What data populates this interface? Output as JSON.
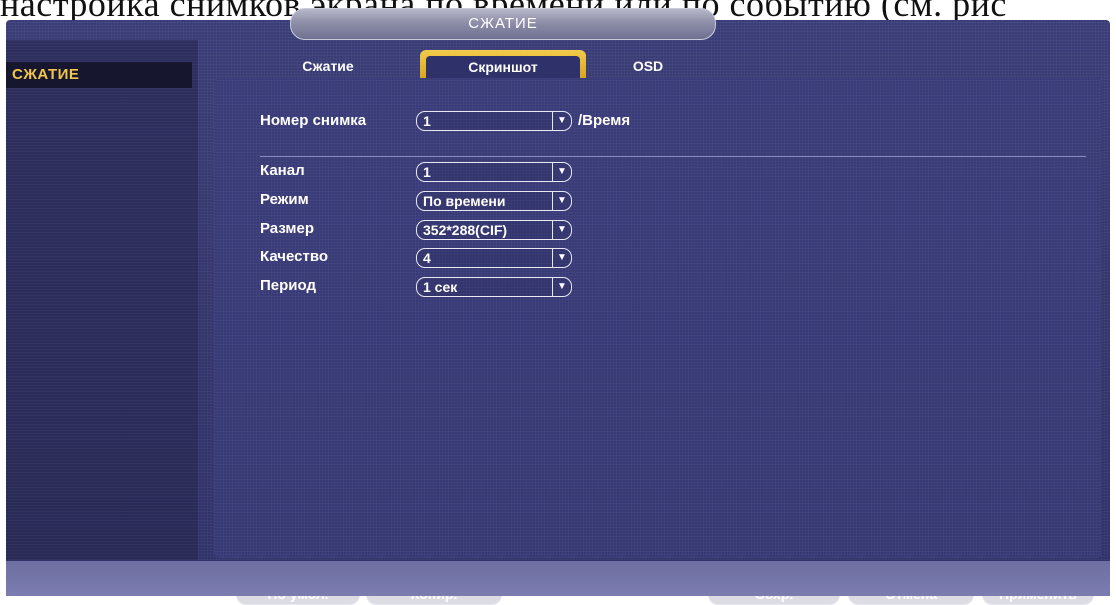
{
  "document": {
    "top_text": "настройка снимков экрана по времени или по событию (см. рис"
  },
  "window": {
    "title": "СЖАТИЕ"
  },
  "sidebar": {
    "items": [
      {
        "label": "СЖАТИЕ",
        "selected": true
      }
    ]
  },
  "tabs": [
    {
      "label": "Сжатие",
      "active": false
    },
    {
      "label": "Скриншот",
      "active": true
    },
    {
      "label": "OSD",
      "active": false
    }
  ],
  "form": {
    "snapshot_number": {
      "label": "Номер снимка",
      "value": "1",
      "suffix": "/Время"
    },
    "fields": [
      {
        "label": "Канал",
        "value": "1"
      },
      {
        "label": "Режим",
        "value": "По времени"
      },
      {
        "label": "Размер",
        "value": "352*288(CIF)"
      },
      {
        "label": "Качество",
        "value": "4"
      },
      {
        "label": "Период",
        "value": "1 сек"
      }
    ]
  },
  "buttons": {
    "default": "По умол.",
    "copy": "Копир.",
    "save": "Сохр.",
    "cancel": "Отмена",
    "apply": "Применить"
  },
  "colors": {
    "accent": "#f1c64a",
    "background": "#3a3c79",
    "text": "#ffffff"
  },
  "icons": {
    "dropdown": "chevron-down-icon"
  }
}
